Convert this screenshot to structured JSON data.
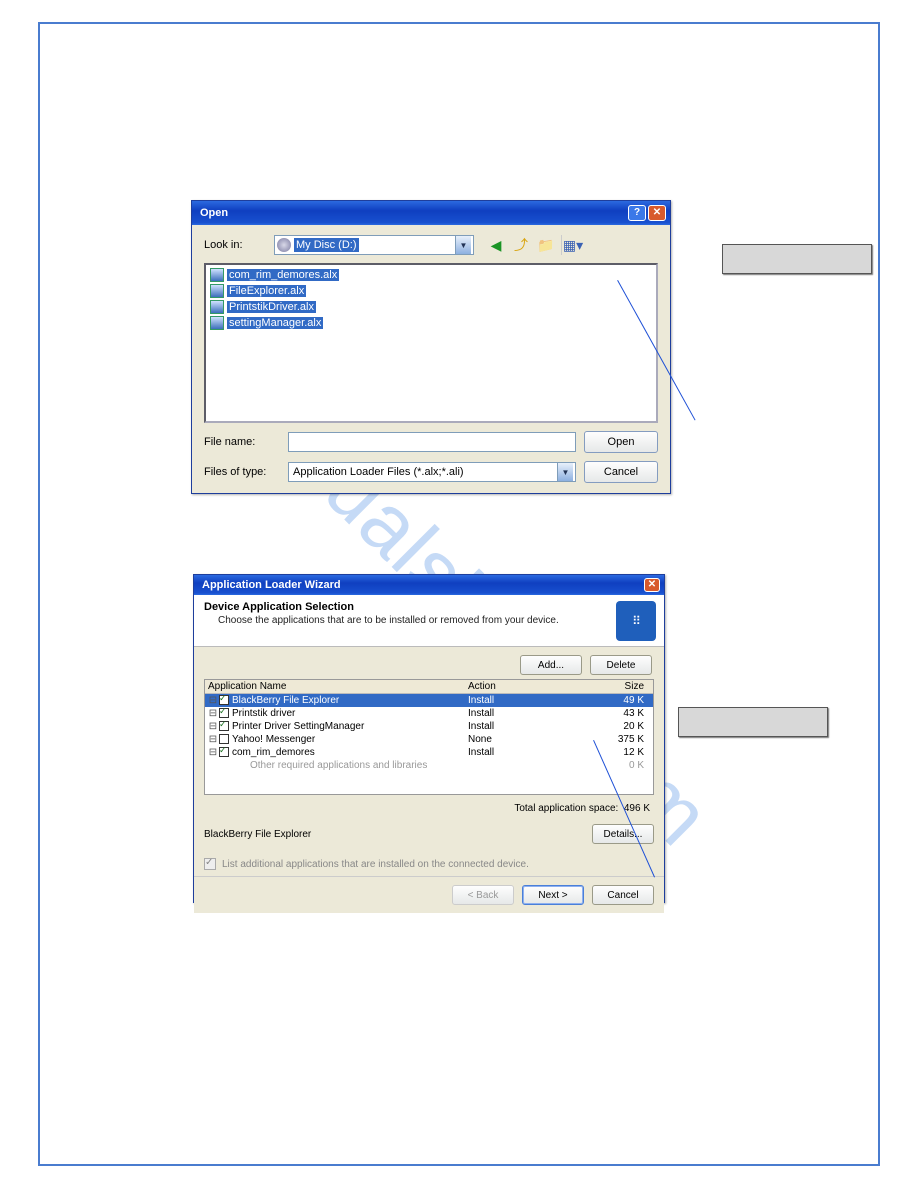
{
  "watermark": "manualshive.com",
  "openDialog": {
    "title": "Open",
    "lookInLabel": "Look in:",
    "lookInValue": "My Disc (D:)",
    "files": [
      "com_rim_demores.alx",
      "FileExplorer.alx",
      "PrintstikDriver.alx",
      "settingManager.alx"
    ],
    "fileNameLabel": "File name:",
    "fileNameValue": "",
    "filesOfTypeLabel": "Files of type:",
    "filesOfTypeValue": "Application Loader Files (*.alx;*.ali)",
    "openButton": "Open",
    "cancelButton": "Cancel"
  },
  "wizard": {
    "title": "Application Loader Wizard",
    "headerTitle": "Device Application Selection",
    "headerSub": "Choose the applications that are to be installed or removed from your device.",
    "addButton": "Add...",
    "deleteButton": "Delete",
    "columns": {
      "name": "Application Name",
      "action": "Action",
      "size": "Size"
    },
    "rows": [
      {
        "name": "BlackBerry File Explorer",
        "action": "Install",
        "size": "49 K",
        "selected": true,
        "checked": true
      },
      {
        "name": "Printstik driver",
        "action": "Install",
        "size": "43 K",
        "checked": true
      },
      {
        "name": "Printer Driver SettingManager",
        "action": "Install",
        "size": "20 K",
        "checked": true
      },
      {
        "name": "Yahoo! Messenger",
        "action": "None",
        "size": "375 K",
        "checked": false
      },
      {
        "name": "com_rim_demores",
        "action": "Install",
        "size": "12 K",
        "checked": true
      },
      {
        "name": "Other required applications and libraries",
        "action": "",
        "size": "0 K",
        "muted": true
      }
    ],
    "totalLabel": "Total application space:",
    "totalValue": "496 K",
    "detailName": "BlackBerry File Explorer",
    "detailsButton": "Details...",
    "listAdditional": "List additional applications that are installed on the connected device.",
    "backButton": "< Back",
    "nextButton": "Next >",
    "cancelButton": "Cancel"
  }
}
